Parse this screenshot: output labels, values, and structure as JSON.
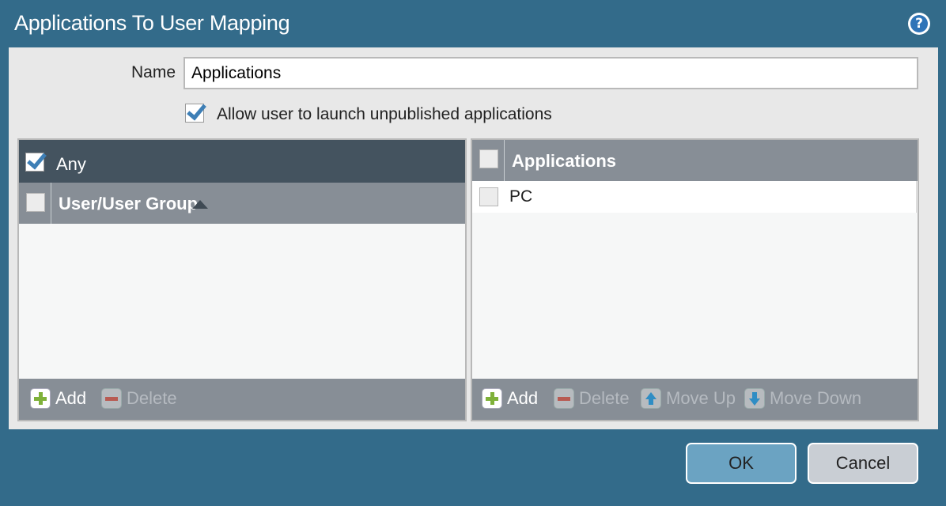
{
  "dialog": {
    "title": "Applications To User Mapping",
    "help_icon": "help-icon",
    "name_label": "Name",
    "name_value": "Applications",
    "allow_label": "Allow user to launch unpublished applications",
    "allow_checked": true
  },
  "users_panel": {
    "any_label": "Any",
    "any_checked": true,
    "column_header": "User/User Group",
    "sort_icon": "sort-ascending-icon",
    "rows": [],
    "footer": {
      "add_label": "Add",
      "delete_label": "Delete"
    }
  },
  "apps_panel": {
    "column_header": "Applications",
    "rows": [
      {
        "label": "PC",
        "checked": false
      }
    ],
    "footer": {
      "add_label": "Add",
      "delete_label": "Delete",
      "move_up_label": "Move Up",
      "move_down_label": "Move Down"
    }
  },
  "buttons": {
    "ok_label": "OK",
    "cancel_label": "Cancel"
  },
  "colors": {
    "frame": "#336b8a",
    "header_dark": "#44535f",
    "header_gray": "#878e96",
    "ok_button": "#6ba3c2",
    "cancel_button": "#c9ced4",
    "checkmark": "#3e7fb6",
    "add_plus": "#7fb13a"
  }
}
